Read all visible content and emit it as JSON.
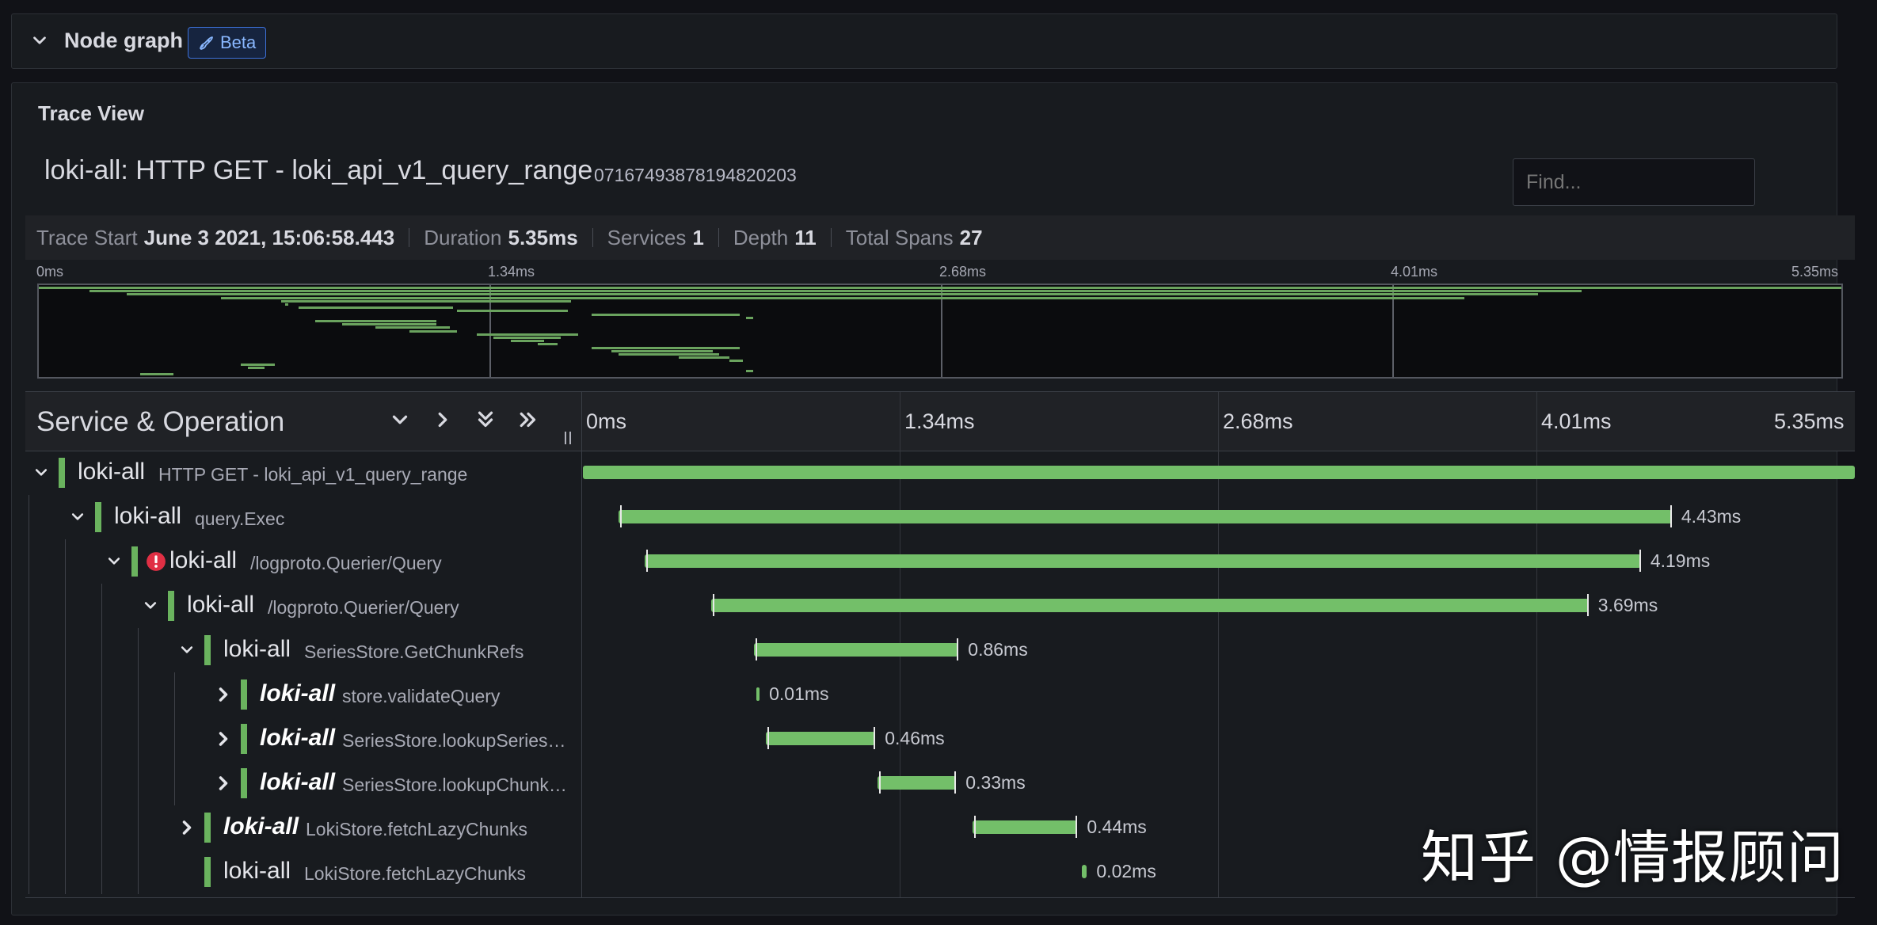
{
  "node_graph": {
    "title": "Node graph",
    "badge": "Beta"
  },
  "trace_view": {
    "panel_title": "Trace View",
    "trace_name": "loki-all: HTTP GET - loki_api_v1_query_range",
    "trace_id": "07167493878194820203",
    "find_placeholder": "Find...",
    "stats": {
      "trace_start_label": "Trace Start",
      "trace_start_value": "June 3 2021, 15:06:58.443",
      "duration_label": "Duration",
      "duration_value": "5.35ms",
      "services_label": "Services",
      "services_value": "1",
      "depth_label": "Depth",
      "depth_value": "11",
      "total_spans_label": "Total Spans",
      "total_spans_value": "27"
    },
    "minimap_ticks": [
      "0ms",
      "1.34ms",
      "2.68ms",
      "4.01ms",
      "5.35ms"
    ],
    "header": {
      "service_operation": "Service & Operation"
    },
    "timeline_ticks": [
      "0ms",
      "1.34ms",
      "2.68ms",
      "4.01ms",
      "5.35ms"
    ],
    "total_ms": 5.35,
    "rows": [
      {
        "service": "loki-all",
        "operation": "HTTP GET - loki_api_v1_query_range",
        "depth": 0,
        "toggle": "expanded",
        "bold": false,
        "error": false,
        "start_ms": 0.0,
        "duration_ms": 5.35,
        "label": ""
      },
      {
        "service": "loki-all",
        "operation": "query.Exec",
        "depth": 1,
        "toggle": "expanded",
        "bold": false,
        "error": false,
        "start_ms": 0.15,
        "duration_ms": 4.43,
        "label": "4.43ms"
      },
      {
        "service": "loki-all",
        "operation": "/logproto.Querier/Query",
        "depth": 2,
        "toggle": "expanded",
        "bold": false,
        "error": true,
        "start_ms": 0.26,
        "duration_ms": 4.19,
        "label": "4.19ms"
      },
      {
        "service": "loki-all",
        "operation": "/logproto.Querier/Query",
        "depth": 3,
        "toggle": "expanded",
        "bold": false,
        "error": false,
        "start_ms": 0.54,
        "duration_ms": 3.69,
        "label": "3.69ms"
      },
      {
        "service": "loki-all",
        "operation": "SeriesStore.GetChunkRefs",
        "depth": 4,
        "toggle": "expanded",
        "bold": false,
        "error": false,
        "start_ms": 0.72,
        "duration_ms": 0.86,
        "label": "0.86ms"
      },
      {
        "service": "loki-all",
        "operation": "store.validateQuery",
        "depth": 5,
        "toggle": "collapsed",
        "bold": true,
        "error": false,
        "start_ms": 0.73,
        "duration_ms": 0.01,
        "label": "0.01ms"
      },
      {
        "service": "loki-all",
        "operation": "SeriesStore.lookupSeries…",
        "depth": 5,
        "toggle": "collapsed",
        "bold": true,
        "error": false,
        "start_ms": 0.77,
        "duration_ms": 0.46,
        "label": "0.46ms"
      },
      {
        "service": "loki-all",
        "operation": "SeriesStore.lookupChunk…",
        "depth": 5,
        "toggle": "collapsed",
        "bold": true,
        "error": false,
        "start_ms": 1.24,
        "duration_ms": 0.33,
        "label": "0.33ms"
      },
      {
        "service": "loki-all",
        "operation": "LokiStore.fetchLazyChunks",
        "depth": 4,
        "toggle": "collapsed",
        "bold": true,
        "error": false,
        "start_ms": 1.64,
        "duration_ms": 0.44,
        "label": "0.44ms"
      },
      {
        "service": "loki-all",
        "operation": "LokiStore.fetchLazyChunks",
        "depth": 4,
        "toggle": "none",
        "bold": false,
        "error": false,
        "start_ms": 2.1,
        "duration_ms": 0.02,
        "label": "0.02ms"
      }
    ]
  },
  "watermark": "知乎 @情报顾问",
  "colors": {
    "span": "#73bf69",
    "service": "#6ab35e",
    "error": "#e02f44",
    "accent": "#3d71d9"
  }
}
